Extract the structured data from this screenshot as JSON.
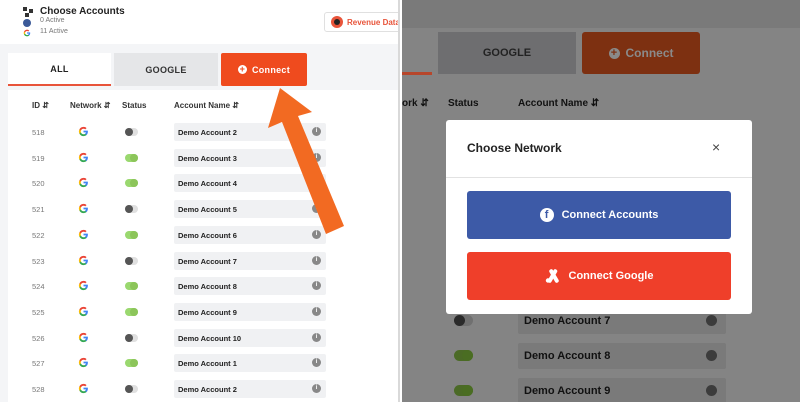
{
  "header": {
    "title": "Choose Accounts",
    "fb_status": "0 Active",
    "google_status": "11 Active",
    "revenue_button": "Revenue Data"
  },
  "tabs": {
    "all": "ALL",
    "google": "GOOGLE",
    "connect": "Connect"
  },
  "table": {
    "headers": {
      "id": "ID",
      "network": "Network",
      "status": "Status",
      "account": "Account Name"
    },
    "rows": [
      {
        "id": "518",
        "network": "google",
        "active": false,
        "name": "Demo Account 2"
      },
      {
        "id": "519",
        "network": "google",
        "active": true,
        "name": "Demo Account 3"
      },
      {
        "id": "520",
        "network": "google",
        "active": true,
        "name": "Demo Account 4"
      },
      {
        "id": "521",
        "network": "google",
        "active": false,
        "name": "Demo Account 5"
      },
      {
        "id": "522",
        "network": "google",
        "active": true,
        "name": "Demo Account 6"
      },
      {
        "id": "523",
        "network": "google",
        "active": false,
        "name": "Demo Account 7"
      },
      {
        "id": "524",
        "network": "google",
        "active": true,
        "name": "Demo Account 8"
      },
      {
        "id": "525",
        "network": "google",
        "active": true,
        "name": "Demo Account 9"
      },
      {
        "id": "526",
        "network": "google",
        "active": false,
        "name": "Demo Account 10"
      },
      {
        "id": "527",
        "network": "google",
        "active": true,
        "name": "Demo Account 1"
      },
      {
        "id": "528",
        "network": "google",
        "active": false,
        "name": "Demo Account 2"
      }
    ]
  },
  "right_bg": {
    "google_tab": "GOOGLE",
    "connect_tab": "Connect",
    "headers": {
      "network_partial": "ork",
      "status": "Status",
      "account": "Account Name"
    },
    "rows": [
      {
        "name": "Demo Account 7",
        "active": false
      },
      {
        "name": "Demo Account 8",
        "active": true
      },
      {
        "name": "Demo Account 9",
        "active": true
      }
    ]
  },
  "modal": {
    "title": "Choose Network",
    "close_icon": "×",
    "facebook_button": "Connect Accounts",
    "google_button": "Connect Google"
  },
  "colors": {
    "accent": "#ef4b1e",
    "facebook": "#3d5aa7",
    "google_button": "#ef3f2a",
    "toggle_on": "#9ad86f"
  }
}
